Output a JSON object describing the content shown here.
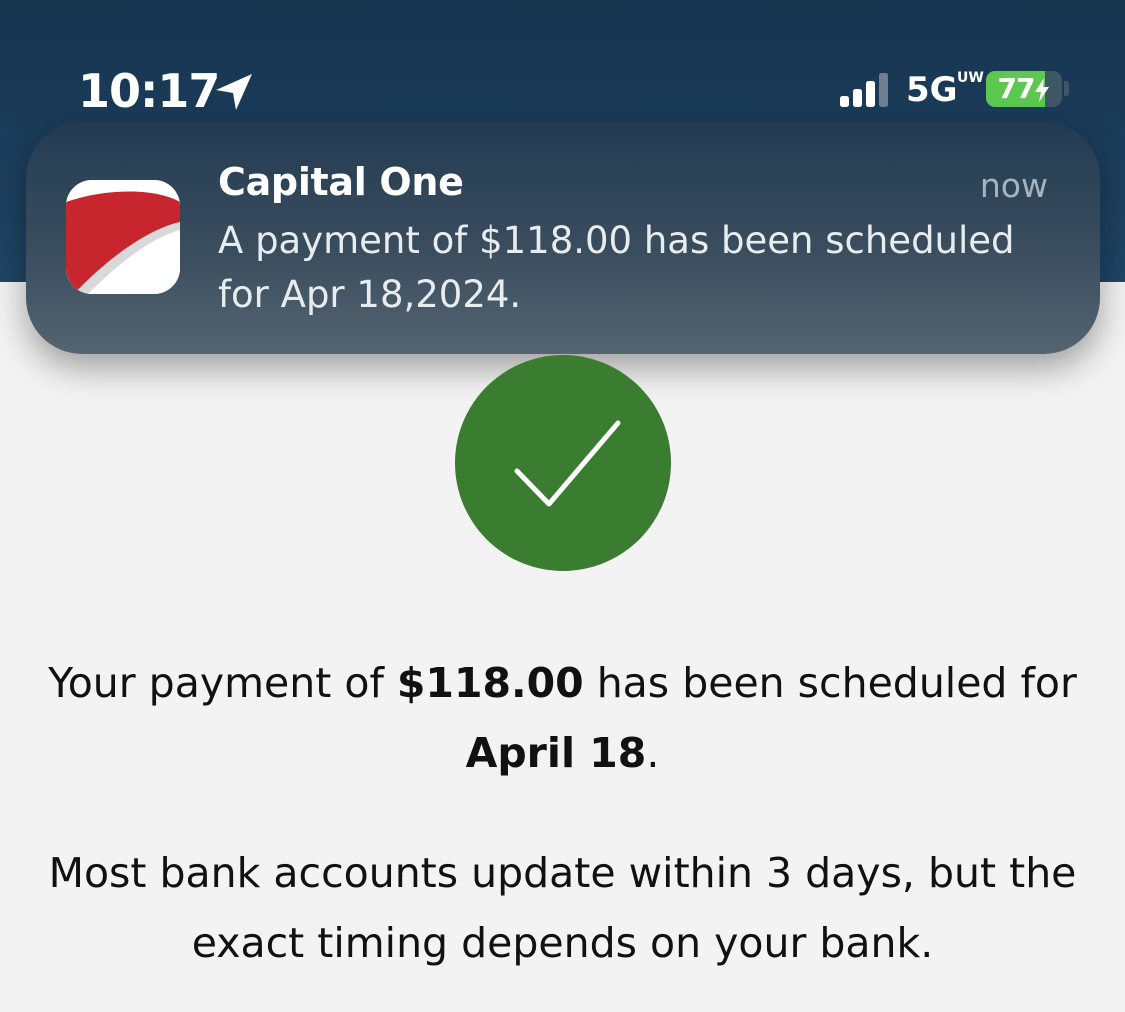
{
  "status_bar": {
    "time": "10:17",
    "network": "5G",
    "network_badge": "UW",
    "battery_percent": 77,
    "battery_label": "77",
    "icons": [
      "location-arrow-icon",
      "signal-bars-icon",
      "battery-icon",
      "charging-bolt-icon"
    ]
  },
  "notification": {
    "app_name": "Capital One",
    "time": "now",
    "body": "A payment of $118.00 has been scheduled for Apr 18,2024.",
    "icon": "capital-one-logo-icon"
  },
  "confirmation": {
    "icon": "checkmark-icon",
    "message_prefix": "Your payment of ",
    "amount": "$118.00",
    "message_middle": " has been scheduled for ",
    "date": "April 18",
    "message_suffix": ".",
    "info": "Most bank accounts update within 3 days, but the exact timing depends on your bank."
  },
  "colors": {
    "header": "#1b3c5a",
    "success": "#3a7d30",
    "battery": "#5cc84f",
    "brand_red": "#c7262e"
  }
}
